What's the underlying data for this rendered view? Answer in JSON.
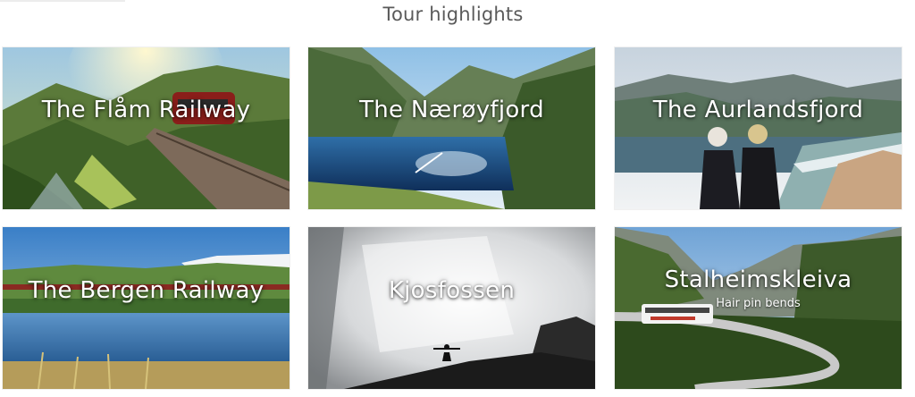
{
  "page": {
    "title": "Tour highlights"
  },
  "tiles": [
    {
      "title": "The Flåm Railway"
    },
    {
      "title": "The Nærøyfjord"
    },
    {
      "title": "The Aurlandsfjord"
    },
    {
      "title": "The Bergen Railway"
    },
    {
      "title": "Kjosfossen"
    },
    {
      "title": "Stalheimskleiva",
      "subtitle": "Hair pin bends"
    }
  ]
}
